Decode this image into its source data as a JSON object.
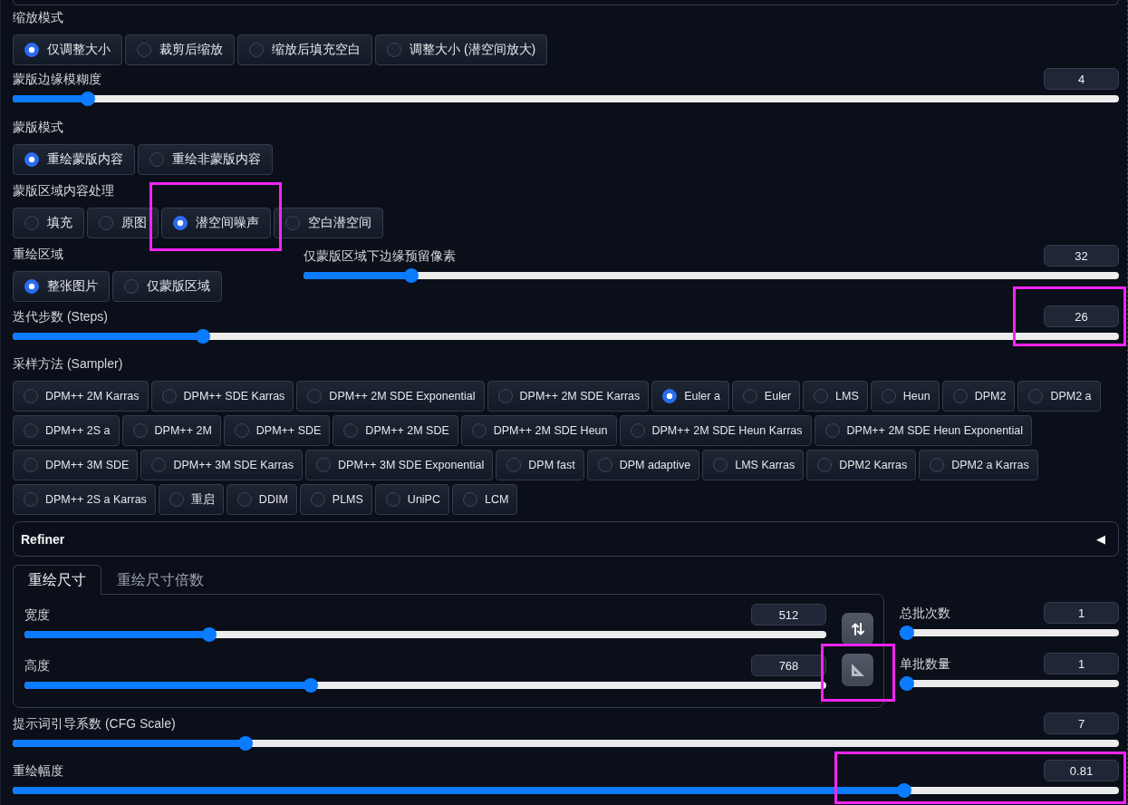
{
  "resize_mode": {
    "label": "缩放模式",
    "options": [
      {
        "label": "仅调整大小",
        "selected": true
      },
      {
        "label": "裁剪后缩放",
        "selected": false
      },
      {
        "label": "缩放后填充空白",
        "selected": false
      },
      {
        "label": "调整大小 (潜空间放大)",
        "selected": false
      }
    ]
  },
  "mask_blur": {
    "label": "蒙版边缘模糊度",
    "value": "4",
    "level": 0.0625
  },
  "mask_mode": {
    "label": "蒙版模式",
    "options": [
      {
        "label": "重绘蒙版内容",
        "selected": true
      },
      {
        "label": "重绘非蒙版内容",
        "selected": false
      }
    ]
  },
  "masked_content": {
    "label": "蒙版区域内容处理",
    "options": [
      {
        "label": "填充",
        "selected": false,
        "highlighted": false
      },
      {
        "label": "原图",
        "selected": false,
        "highlighted": false
      },
      {
        "label": "潜空间噪声",
        "selected": true,
        "highlighted": true
      },
      {
        "label": "空白潜空间",
        "selected": false,
        "highlighted": false
      }
    ]
  },
  "inpaint_area": {
    "label": "重绘区域",
    "options": [
      {
        "label": "整张图片",
        "selected": true
      },
      {
        "label": "仅蒙版区域",
        "selected": false
      }
    ]
  },
  "only_masked_padding": {
    "label": "仅蒙版区域下边缘预留像素",
    "value": "32",
    "level": 0.125
  },
  "steps": {
    "label": "迭代步数 (Steps)",
    "value": "26",
    "level": 0.168,
    "highlighted": true
  },
  "sampler": {
    "label": "采样方法 (Sampler)",
    "options": [
      {
        "label": "DPM++ 2M Karras",
        "selected": false
      },
      {
        "label": "DPM++ SDE Karras",
        "selected": false
      },
      {
        "label": "DPM++ 2M SDE Exponential",
        "selected": false
      },
      {
        "label": "DPM++ 2M SDE Karras",
        "selected": false
      },
      {
        "label": "Euler a",
        "selected": true
      },
      {
        "label": "Euler",
        "selected": false
      },
      {
        "label": "LMS",
        "selected": false
      },
      {
        "label": "Heun",
        "selected": false
      },
      {
        "label": "DPM2",
        "selected": false
      },
      {
        "label": "DPM2 a",
        "selected": false
      },
      {
        "label": "DPM++ 2S a",
        "selected": false
      },
      {
        "label": "DPM++ 2M",
        "selected": false
      },
      {
        "label": "DPM++ SDE",
        "selected": false
      },
      {
        "label": "DPM++ 2M SDE",
        "selected": false
      },
      {
        "label": "DPM++ 2M SDE Heun",
        "selected": false
      },
      {
        "label": "DPM++ 2M SDE Heun Karras",
        "selected": false
      },
      {
        "label": "DPM++ 2M SDE Heun Exponential",
        "selected": false
      },
      {
        "label": "DPM++ 3M SDE",
        "selected": false
      },
      {
        "label": "DPM++ 3M SDE Karras",
        "selected": false
      },
      {
        "label": "DPM++ 3M SDE Exponential",
        "selected": false
      },
      {
        "label": "DPM fast",
        "selected": false
      },
      {
        "label": "DPM adaptive",
        "selected": false
      },
      {
        "label": "LMS Karras",
        "selected": false
      },
      {
        "label": "DPM2 Karras",
        "selected": false
      },
      {
        "label": "DPM2 a Karras",
        "selected": false
      },
      {
        "label": "DPM++ 2S a Karras",
        "selected": false
      },
      {
        "label": "重启",
        "selected": false
      },
      {
        "label": "DDIM",
        "selected": false
      },
      {
        "label": "PLMS",
        "selected": false
      },
      {
        "label": "UniPC",
        "selected": false
      },
      {
        "label": "LCM",
        "selected": false
      }
    ]
  },
  "refiner": {
    "title": "Refiner",
    "icon": "◀"
  },
  "size_tabs": [
    {
      "label": "重绘尺寸",
      "selected": true
    },
    {
      "label": "重绘尺寸倍数",
      "selected": false
    }
  ],
  "width": {
    "label": "宽度",
    "value": "512",
    "level": 0.226
  },
  "height": {
    "label": "高度",
    "value": "768",
    "level": 0.355
  },
  "size_buttons": [
    {
      "kind": "swap",
      "highlighted": false
    },
    {
      "kind": "ratio",
      "highlighted": true
    }
  ],
  "batch_count": {
    "label": "总批次数",
    "value": "1",
    "level": 0
  },
  "batch_size": {
    "label": "单批数量",
    "value": "1",
    "level": 0
  },
  "cfg_scale": {
    "label": "提示词引导系数 (CFG Scale)",
    "value": "7",
    "level": 0.207
  },
  "denoising_strength": {
    "label": "重绘幅度",
    "value": "0.81",
    "level": 0.81,
    "highlighted": true
  }
}
